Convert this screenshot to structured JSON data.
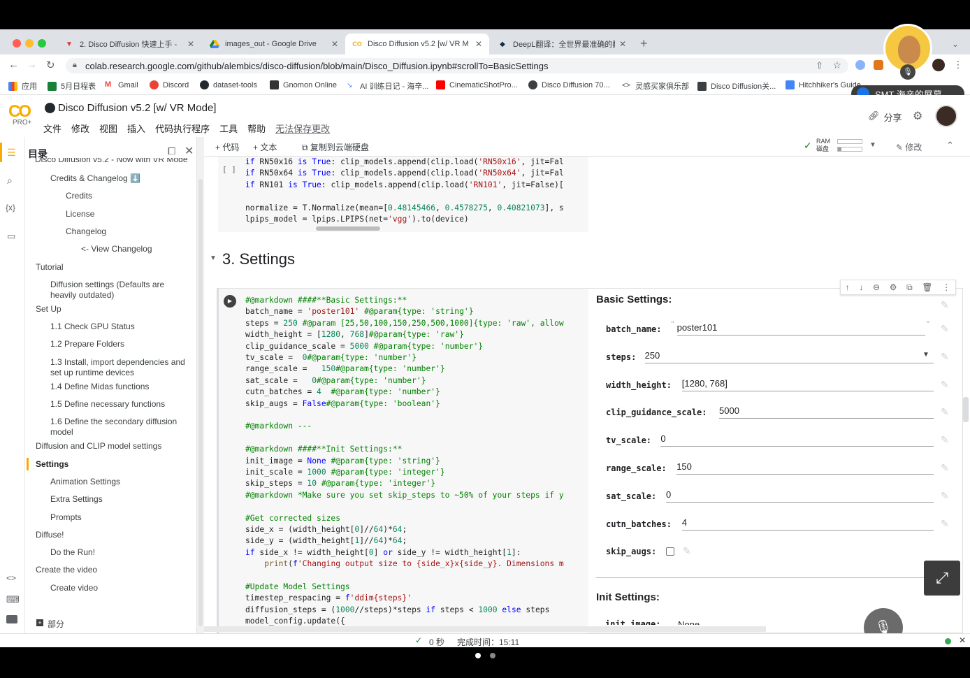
{
  "browser": {
    "tabs": [
      {
        "label": "2. Disco Diffusion 快速上手 - ",
        "icon": "vpn-icon"
      },
      {
        "label": "images_out - Google Drive",
        "icon": "google-drive-icon"
      },
      {
        "label": "Disco Diffusion v5.2 [w/ VR M",
        "icon": "colab-icon"
      },
      {
        "label": "DeepL翻译：全世界最准确的翻",
        "icon": "deepl-icon"
      }
    ],
    "url": "colab.research.google.com/github/alembics/disco-diffusion/blob/main/Disco_Diffusion.ipynb#scrollTo=BasicSettings",
    "bookmarks": [
      "应用",
      "5月日程表",
      "Gmail",
      "Discord",
      "dataset-tools",
      "Gnomon Online",
      "AI 训练日记 - 海辛...",
      "CinematicShotPro...",
      "Disco Diffusion 70...",
      "灵感买家俱乐部",
      "Disco Diffusion关...",
      "Hitchhiker's Guide"
    ],
    "share_badge": "SMT 海辛的屏幕..."
  },
  "colab": {
    "logo": "CO",
    "plan": "PRO+",
    "title": "Disco Diffusion v5.2 [w/ VR Mode]",
    "menu": [
      "文件",
      "修改",
      "视图",
      "插入",
      "代码执行程序",
      "工具",
      "帮助"
    ],
    "unsaved": "无法保存更改",
    "share": "分享",
    "toolbar": {
      "add_code": "+ 代码",
      "add_text": "+ 文本",
      "copy_drive": "复制到云端硬盘",
      "ram": "RAM",
      "disk": "磁盘",
      "edit": "修改"
    }
  },
  "toc": {
    "title": "目录",
    "items": [
      {
        "label": "Credits & Changelog ⬇️",
        "level": 1
      },
      {
        "label": "Credits",
        "level": 2
      },
      {
        "label": "License",
        "level": 2
      },
      {
        "label": "Changelog",
        "level": 2
      },
      {
        "label": "<- View Changelog",
        "level": 3
      },
      {
        "label": "Tutorial",
        "level": 0
      },
      {
        "label": "Diffusion settings (Defaults are",
        "label2": "heavily outdated)",
        "level": 1
      },
      {
        "label": "Set Up",
        "level": 0
      },
      {
        "label": "1.1 Check GPU Status",
        "level": 1
      },
      {
        "label": "1.2 Prepare Folders",
        "level": 1
      },
      {
        "label": "1.3 Install, import dependencies and",
        "label2": "set up runtime devices",
        "level": 1
      },
      {
        "label": "1.4 Define Midas functions",
        "level": 1
      },
      {
        "label": "1.5 Define necessary functions",
        "level": 1
      },
      {
        "label": "1.6 Define the secondary diffusion",
        "label2": "model",
        "level": 1
      },
      {
        "label": "Diffusion and CLIP model settings",
        "level": 0
      },
      {
        "label": "Settings",
        "level": 0,
        "active": true
      },
      {
        "label": "Animation Settings",
        "level": 1
      },
      {
        "label": "Extra Settings",
        "level": 1
      },
      {
        "label": "Prompts",
        "level": 1
      },
      {
        "label": "Diffuse!",
        "level": 0
      },
      {
        "label": "Do the Run!",
        "level": 1
      },
      {
        "label": "Create the video",
        "level": 0
      },
      {
        "label": "Create video",
        "level": 1
      }
    ],
    "add_section": "部分"
  },
  "top_cell": {
    "bracket": "[ ]",
    "lines": [
      [
        "if",
        " RN50x16 ",
        "is",
        " ",
        "True",
        ": clip_models.append(clip.load(",
        "'RN50x16'",
        ", jit=Fal"
      ],
      [
        "if",
        " RN50x64 ",
        "is",
        " ",
        "True",
        ": clip_models.append(clip.load(",
        "'RN50x64'",
        ", jit=Fal"
      ],
      [
        "if",
        " RN101 ",
        "is",
        " ",
        "True",
        ": clip_models.append(clip.load(",
        "'RN101'",
        ", jit=False)["
      ]
    ],
    "normalize": [
      "normalize = T.Normalize(mean=[",
      "0.48145466",
      ", ",
      "0.4578275",
      ", ",
      "0.40821073",
      "], s"
    ],
    "lpips": [
      "lpips_model = lpips.LPIPS(net=",
      "'vgg'",
      ").to(device)"
    ]
  },
  "section_title": "3. Settings",
  "settings_code": [
    "#@markdown ####**Basic Settings:**",
    "batch_name = 'poster101' #@param{type: 'string'}",
    "steps = 250 #@param [25,50,100,150,250,500,1000]{type: 'raw', allow",
    "width_height = [1280, 768]#@param{type: 'raw'}",
    "clip_guidance_scale = 5000 #@param{type: 'number'}",
    "tv_scale =  0#@param{type: 'number'}",
    "range_scale =   150#@param{type: 'number'}",
    "sat_scale =   0#@param{type: 'number'}",
    "cutn_batches = 4  #@param{type: 'number'}",
    "skip_augs = False#@param{type: 'boolean'}",
    "",
    "#@markdown ---",
    "",
    "#@markdown ####**Init Settings:**",
    "init_image = None #@param{type: 'string'}",
    "init_scale = 1000 #@param{type: 'integer'}",
    "skip_steps = 10 #@param{type: 'integer'}",
    "#@markdown *Make sure you set skip_steps to ~50% of your steps if y",
    "",
    "#Get corrected sizes",
    "side_x = (width_height[0]//64)*64;",
    "side_y = (width_height[1]//64)*64;",
    "if side_x != width_height[0] or side_y != width_height[1]:",
    "    print(f'Changing output size to {side_x}x{side_y}. Dimensions m",
    "",
    "#Update Model Settings",
    "timestep_respacing = f'ddim{steps}'",
    "diffusion_steps = (1000//steps)*steps if steps < 1000 else steps",
    "model_config.update({"
  ],
  "form": {
    "heading": "Basic Settings:",
    "fields": [
      {
        "label": "batch_name:",
        "value": "poster101",
        "kind": "text-quoted"
      },
      {
        "label": "steps:",
        "value": "250",
        "kind": "select"
      },
      {
        "label": "width_height:",
        "value": "[1280, 768]",
        "kind": "text"
      },
      {
        "label": "clip_guidance_scale:",
        "value": "5000",
        "kind": "text"
      },
      {
        "label": "tv_scale:",
        "value": "0",
        "kind": "text"
      },
      {
        "label": "range_scale:",
        "value": "150",
        "kind": "text"
      },
      {
        "label": "sat_scale:",
        "value": "0",
        "kind": "text"
      },
      {
        "label": "cutn_batches:",
        "value": "4",
        "kind": "text"
      },
      {
        "label": "skip_augs:",
        "value": "",
        "kind": "checkbox"
      }
    ],
    "heading2": "Init Settings:",
    "next_label": "init_image:",
    "next_value": "None"
  },
  "status": {
    "time": "0 秒",
    "done": "完成时间：15:11"
  },
  "colors": {
    "accent": "#f9ab00",
    "keyword": "#0000ff",
    "string": "#a31515",
    "number": "#098658",
    "comment": "#008000"
  }
}
